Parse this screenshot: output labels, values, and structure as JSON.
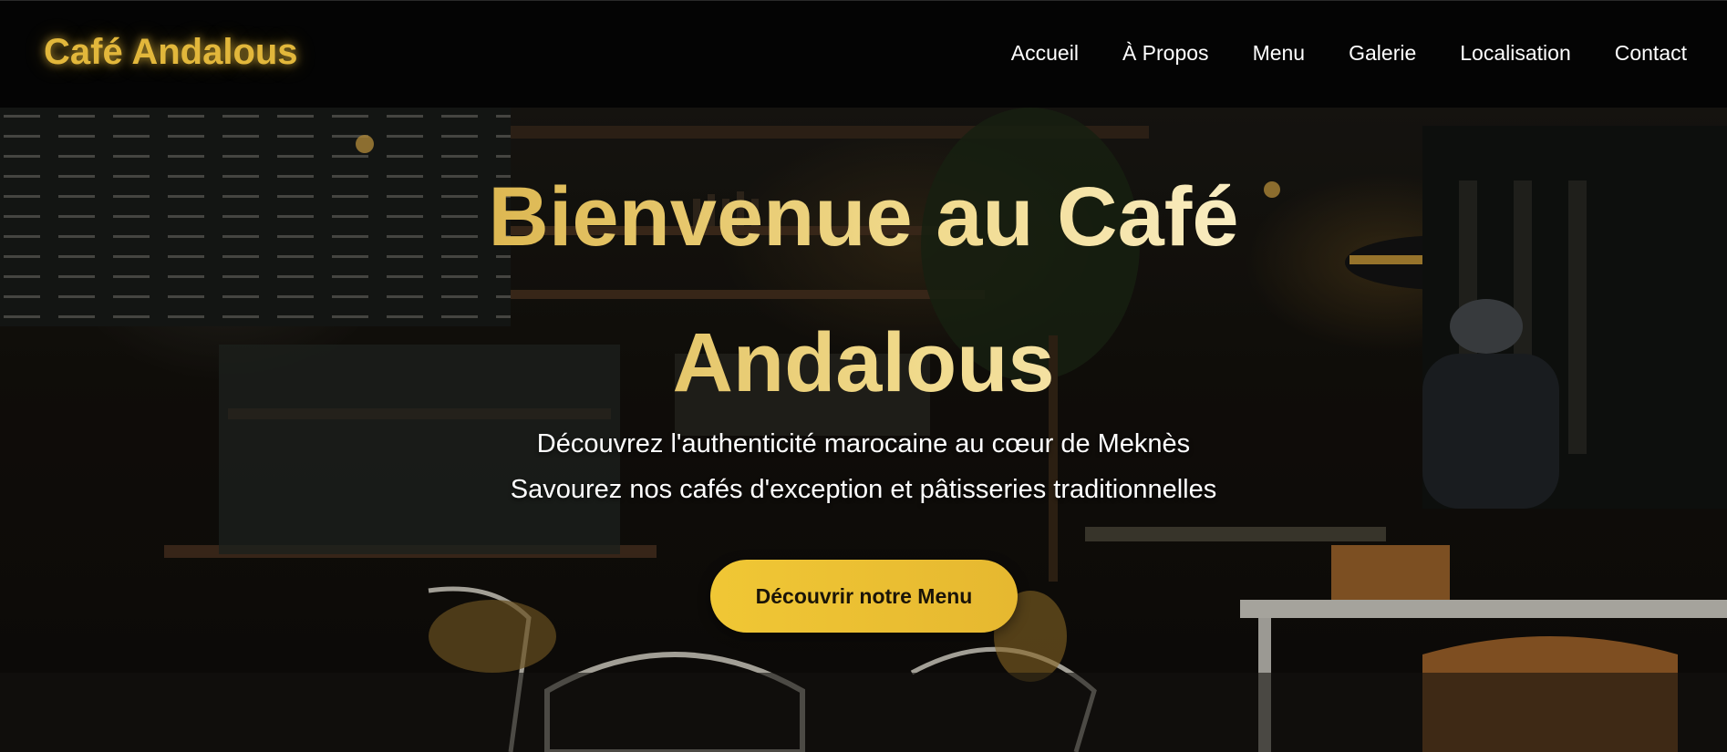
{
  "header": {
    "brand": "Café Andalous",
    "nav": [
      "Accueil",
      "À Propos",
      "Menu",
      "Galerie",
      "Localisation",
      "Contact"
    ]
  },
  "hero": {
    "title": "Bienvenue au Café Andalous",
    "subtitle_1": "Découvrez l'authenticité marocaine au cœur de Meknès",
    "subtitle_2": "Savourez nos cafés d'exception et pâtisseries traditionnelles",
    "cta_label": "Découvrir notre Menu"
  },
  "colors": {
    "brand_gold": "#e2b73b",
    "cta_gold": "#f0c735",
    "header_bg": "#040404"
  }
}
